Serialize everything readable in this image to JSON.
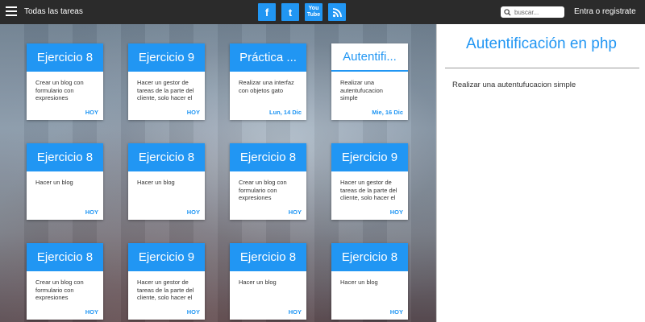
{
  "header": {
    "title": "Todas las tareas",
    "search_placeholder": "buscar...",
    "login_label": "Entra o registrate",
    "social": [
      {
        "name": "facebook",
        "glyph": "f"
      },
      {
        "name": "twitter",
        "glyph": "t"
      },
      {
        "name": "youtube",
        "glyph": "You Tube"
      },
      {
        "name": "rss",
        "glyph": "rss"
      }
    ]
  },
  "cards": [
    {
      "title": "Ejercicio 8",
      "desc": "Crear un blog con formulario con expresiones",
      "date": "HOY",
      "style": "filled"
    },
    {
      "title": "Ejercicio 9",
      "desc": "Hacer un gestor de tareas de la parte del cliente, solo hacer el",
      "date": "HOY",
      "style": "filled"
    },
    {
      "title": "Práctica ...",
      "desc": "Realizar una interfaz con objetos gato",
      "date": "Lun, 14 Dic",
      "style": "filled"
    },
    {
      "title": "Autentifi...",
      "desc": "Realizar una autentufucacion simple",
      "date": "Mie, 16 Dic",
      "style": "outline"
    },
    {
      "title": "Ejercicio 8",
      "desc": "Hacer un blog",
      "date": "HOY",
      "style": "filled"
    },
    {
      "title": "Ejercicio 8",
      "desc": "Hacer un blog",
      "date": "HOY",
      "style": "filled"
    },
    {
      "title": "Ejercicio 8",
      "desc": "Crear un blog con formulario con expresiones",
      "date": "HOY",
      "style": "filled"
    },
    {
      "title": "Ejercicio 9",
      "desc": "Hacer un gestor de tareas de la parte del cliente, solo hacer el",
      "date": "HOY",
      "style": "filled"
    },
    {
      "title": "Ejercicio 8",
      "desc": "Crear un blog con formulario con expresiones",
      "date": "HOY",
      "style": "filled"
    },
    {
      "title": "Ejercicio 9",
      "desc": "Hacer un gestor de tareas de la parte del cliente, solo hacer el",
      "date": "HOY",
      "style": "filled"
    },
    {
      "title": "Ejercicio 8",
      "desc": "Hacer un blog",
      "date": "HOY",
      "style": "filled"
    },
    {
      "title": "Ejercicio 8",
      "desc": "Hacer un blog",
      "date": "HOY",
      "style": "filled"
    }
  ],
  "detail": {
    "title": "Autentificación en php",
    "description": "Realizar una autentufucacion simple"
  },
  "colors": {
    "accent": "#2196f3",
    "topbar": "#2b2b2b"
  }
}
